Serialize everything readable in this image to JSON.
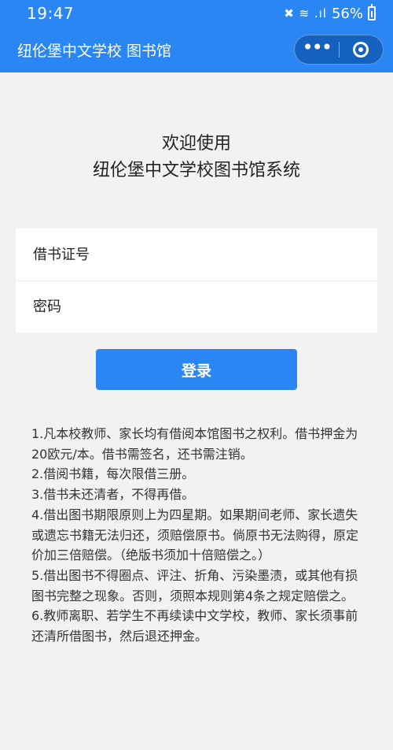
{
  "status_bar": {
    "time": "19:47",
    "icons": "✖ ≋ .ıl",
    "battery": "56%"
  },
  "nav": {
    "title": "纽伦堡中文学校 图书馆",
    "more_icon": "more-dots-icon",
    "close_icon": "target-icon"
  },
  "welcome": {
    "line1": "欢迎使用",
    "line2": "纽伦堡中文学校图书馆系统"
  },
  "form": {
    "card_placeholder": "借书证号",
    "password_placeholder": "密码"
  },
  "login_label": "登录",
  "rules": [
    "1.凡本校教师、家长均有借阅本馆图书之权利。借书押金为20欧元/本。借书需签名，还书需注销。",
    "2.借阅书籍，每次限借三册。",
    "3.借书未还清者，不得再借。",
    "4.借出图书期限原则上为四星期。如果期间老师、家长遗失或遗忘书籍无法归还，须赔偿原书。倘原书无法购得，原定价加三倍赔偿。（绝版书须加十倍赔偿之。）",
    "5.借出图书不得圈点、评注、折角、污染墨渍，或其他有损图书完整之现象。否则，须照本规则第4条之规定赔偿之。",
    "6.教师离职、若学生不再续读中文学校，教师、家长须事前还清所借图书，然后退还押金。"
  ],
  "colors": {
    "primary": "#2a86f2",
    "background": "#f2f2f2"
  }
}
